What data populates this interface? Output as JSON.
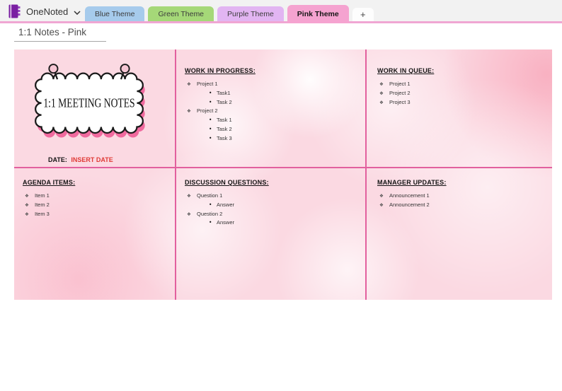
{
  "header": {
    "app_name": "OneNoted",
    "accent_line_color": "#f0a6d3",
    "tabs": [
      {
        "label": "Blue Theme",
        "color": "#a6cbec",
        "active": false
      },
      {
        "label": "Green Theme",
        "color": "#a5d878",
        "active": false
      },
      {
        "label": "Purple Theme",
        "color": "#e2b5f2",
        "active": false
      },
      {
        "label": "Pink Theme",
        "color": "#f5a3d0",
        "active": true
      }
    ],
    "add_tab_label": "+"
  },
  "page": {
    "title": "1:1 Notes - Pink"
  },
  "canvas": {
    "background_color": "#fbd9e2",
    "divider_color": "#e2609e",
    "bullets": {
      "level1": "❖",
      "level2": "•"
    },
    "note_card": {
      "title": "1:1 MEETING NOTES",
      "date_label": "DATE:",
      "date_value": "INSERT DATE",
      "date_value_color": "#e03a36"
    },
    "sections": [
      {
        "id": "work_in_progress",
        "heading": "WORK IN PROGRESS:",
        "items": [
          {
            "level": 1,
            "text": "Project 1"
          },
          {
            "level": 2,
            "text": "Task1"
          },
          {
            "level": 2,
            "text": "Task 2"
          },
          {
            "level": 1,
            "text": "Project 2"
          },
          {
            "level": 2,
            "text": "Task 1"
          },
          {
            "level": 2,
            "text": "Task 2"
          },
          {
            "level": 2,
            "text": "Task 3"
          }
        ]
      },
      {
        "id": "work_in_queue",
        "heading": "WORK IN QUEUE:",
        "items": [
          {
            "level": 1,
            "text": "Project 1"
          },
          {
            "level": 1,
            "text": "Project 2"
          },
          {
            "level": 1,
            "text": "Project 3"
          }
        ]
      },
      {
        "id": "agenda_items",
        "heading": "AGENDA ITEMS:",
        "items": [
          {
            "level": 1,
            "text": "Item 1"
          },
          {
            "level": 1,
            "text": "Item 2"
          },
          {
            "level": 1,
            "text": "Item 3"
          }
        ]
      },
      {
        "id": "discussion_questions",
        "heading": "DISCUSSION QUESTIONS:",
        "items": [
          {
            "level": 1,
            "text": "Question 1"
          },
          {
            "level": 2,
            "text": "Answer"
          },
          {
            "level": 1,
            "text": "Question 2"
          },
          {
            "level": 2,
            "text": "Answer"
          }
        ]
      },
      {
        "id": "manager_updates",
        "heading": "MANAGER UPDATES:",
        "items": [
          {
            "level": 1,
            "text": "Announcement 1"
          },
          {
            "level": 1,
            "text": "Announcement 2"
          }
        ]
      }
    ]
  }
}
